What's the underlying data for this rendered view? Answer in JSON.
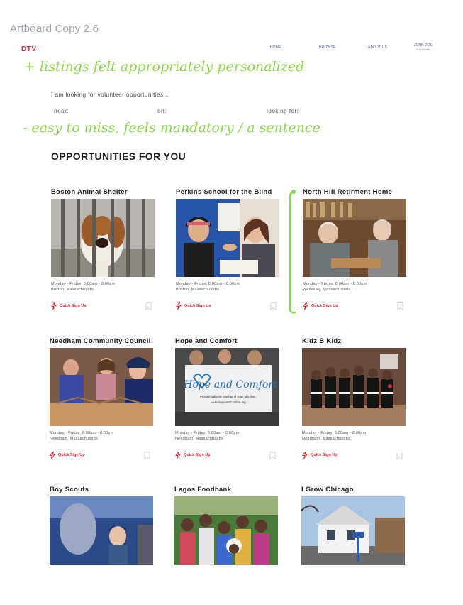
{
  "artboard_title": "Artboard Copy 2.6",
  "header": {
    "logo": "DTV",
    "nav": [
      "HOME",
      "BROWSE",
      "ABOUT US"
    ],
    "user_name": "JOHN DOE",
    "user_sub": "Edit Profile"
  },
  "annotations": {
    "note_top": "+ listings felt appropriately personalized",
    "note_bottom": "- easy to miss, feels mandatory / a sentence"
  },
  "search": {
    "lead": "I am looking for volunteer opportunities...",
    "near_label": "near:",
    "on_label": "on:",
    "looking_for_label": "looking for:"
  },
  "section_title": "OPPORTUNITIES FOR YOU",
  "quick_signup_label": "Quick Sign Up",
  "colors": {
    "brand_red": "#e0283a",
    "annotation_green": "#8bd64a",
    "nav_blue": "#4a5a8a"
  },
  "cards": [
    {
      "title": "Boston Animal Shelter",
      "schedule": "Monday - Friday, 8:00am - 8:00pm",
      "location": "Boston, Massachusetts",
      "image": "dog-in-kennel"
    },
    {
      "title": "Perkins School for the Blind",
      "schedule": "Monday - Friday, 8:00am - 8:00pm",
      "location": "Boston, Massachusetts",
      "image": "teacher-and-student"
    },
    {
      "title": "North Hill Retirment Home",
      "schedule": "Monday - Friday, 8:00am - 8:00pm",
      "location": "Wellesley, Massachusetts",
      "image": "elderly-couple"
    },
    {
      "title": "Needham Community Council",
      "schedule": "Monday - Friday, 8:00am - 8:00pm",
      "location": "Needham, Massachusetts",
      "image": "volunteers-packing"
    },
    {
      "title": "Hope and Comfort",
      "schedule": "Monday - Friday, 8:00am - 8:00pm",
      "location": "Needham, Massachusetts",
      "image": "hope-and-comfort-banner",
      "banner_text": "Hope and Comfort",
      "banner_sub": "Providing dignity one bar of soap at a time.",
      "banner_url": "www.HopeandComfort.org"
    },
    {
      "title": "Kidz B Kidz",
      "schedule": "Monday - Friday, 8:00am - 8:00pm",
      "location": "Needham, Massachusetts",
      "image": "kids-group"
    },
    {
      "title": "Boy Scouts",
      "image": "scout-saluting"
    },
    {
      "title": "Lagos Foodbank",
      "image": "crowd-of-children"
    },
    {
      "title": "I Grow Chicago",
      "image": "house-street"
    }
  ]
}
